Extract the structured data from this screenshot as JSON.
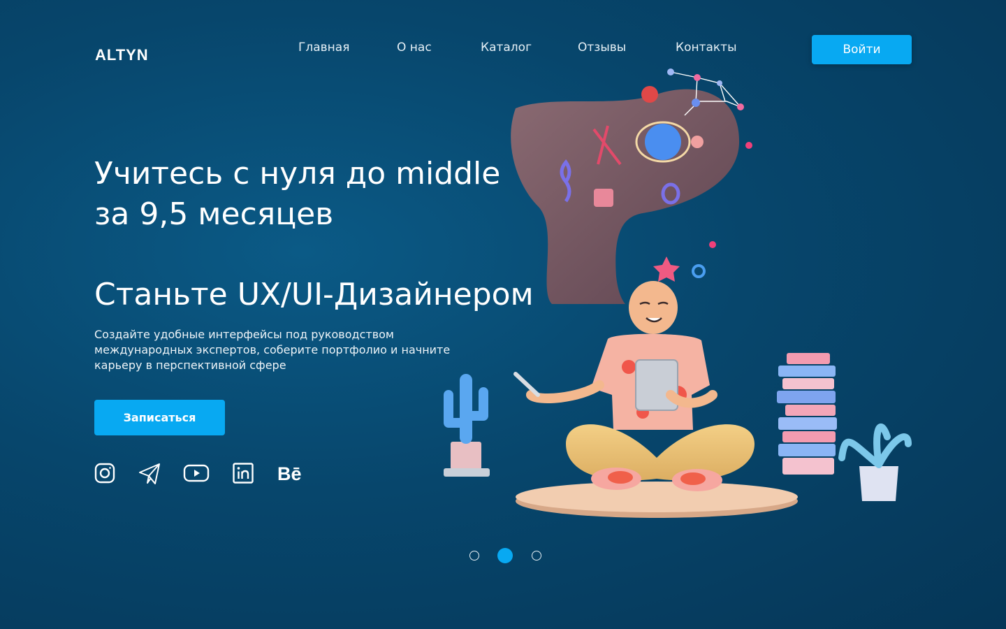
{
  "brand": {
    "logo_text": "ALTYN"
  },
  "nav": {
    "items": [
      {
        "label": "Главная"
      },
      {
        "label": "О нас"
      },
      {
        "label": "Каталог"
      },
      {
        "label": "Отзывы"
      },
      {
        "label": "Контакты"
      }
    ],
    "login_label": "Войти"
  },
  "hero": {
    "headline_line1": "Учитесь с нуля до middle",
    "headline_line2": "за 9,5 месяцев",
    "subheadline": "Станьте UX/UI-Дизайнером",
    "description": "Создайте удобные интерфейсы под руководством международных экспертов, соберите портфолио и начните карьеру в перспективной сфере",
    "cta_label": "Записаться"
  },
  "socials": [
    {
      "icon": "instagram-icon"
    },
    {
      "icon": "telegram-icon"
    },
    {
      "icon": "youtube-icon"
    },
    {
      "icon": "linkedin-icon"
    },
    {
      "icon": "behance-icon",
      "text": "Bē"
    }
  ],
  "carousel": {
    "slide_count": 3,
    "active_slide": 2
  },
  "colors": {
    "accent": "#08a9f2",
    "background": "#07466c",
    "text": "#ffffff"
  }
}
